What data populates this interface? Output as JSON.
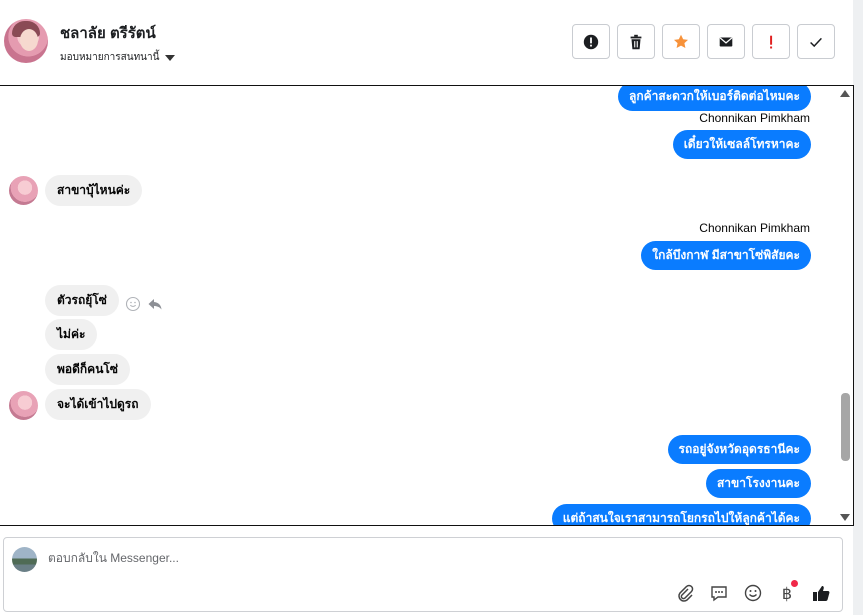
{
  "header": {
    "contact_name": "ชลาลัย ตรีรัตน์",
    "assign_label": "มอบหมายการสนทนานี้",
    "actions": [
      {
        "name": "report-spam-button",
        "icon": "exclamation-circle-icon"
      },
      {
        "name": "delete-button",
        "icon": "trash-icon"
      },
      {
        "name": "star-button",
        "icon": "star-icon",
        "color": "#f7923a"
      },
      {
        "name": "mark-unread-button",
        "icon": "envelope-icon"
      },
      {
        "name": "follow-up-button",
        "icon": "exclamation-icon",
        "color": "#e02020"
      },
      {
        "name": "mark-done-button",
        "icon": "check-icon"
      }
    ]
  },
  "messages": {
    "m1": "ลูกค้าสะดวกให้เบอร์ติดต่อไหมคะ",
    "sender1": "Chonnikan Pimkham",
    "m2": "เดี๋ยวให้เซลล์โทรหาคะ",
    "m3": "สาขาบุ้ไหนค่ะ",
    "sender2": "Chonnikan Pimkham",
    "m4": "ใกล้บึงกาฬ มีสาขาโซ่พิสัยคะ",
    "m5": "ตัวรถยุ้โซ่",
    "m6": "ไม่ค่ะ",
    "m7": "พอดีก็คนโซ่",
    "m8": "จะได้เข้าไปดูรถ",
    "m9": "รถอยู่จังหวัดอุดรธานีคะ",
    "m10": "สาขาโรงงานคะ",
    "m11": "แต่ถ้าสนใจเราสามารถโยกรถไปให้ลูกค้าได้คะ"
  },
  "colors": {
    "outgoing_bubble": "#0a7cff",
    "incoming_bubble": "#f0f0f0"
  },
  "composer": {
    "placeholder": "ตอบกลับใน Messenger..."
  }
}
